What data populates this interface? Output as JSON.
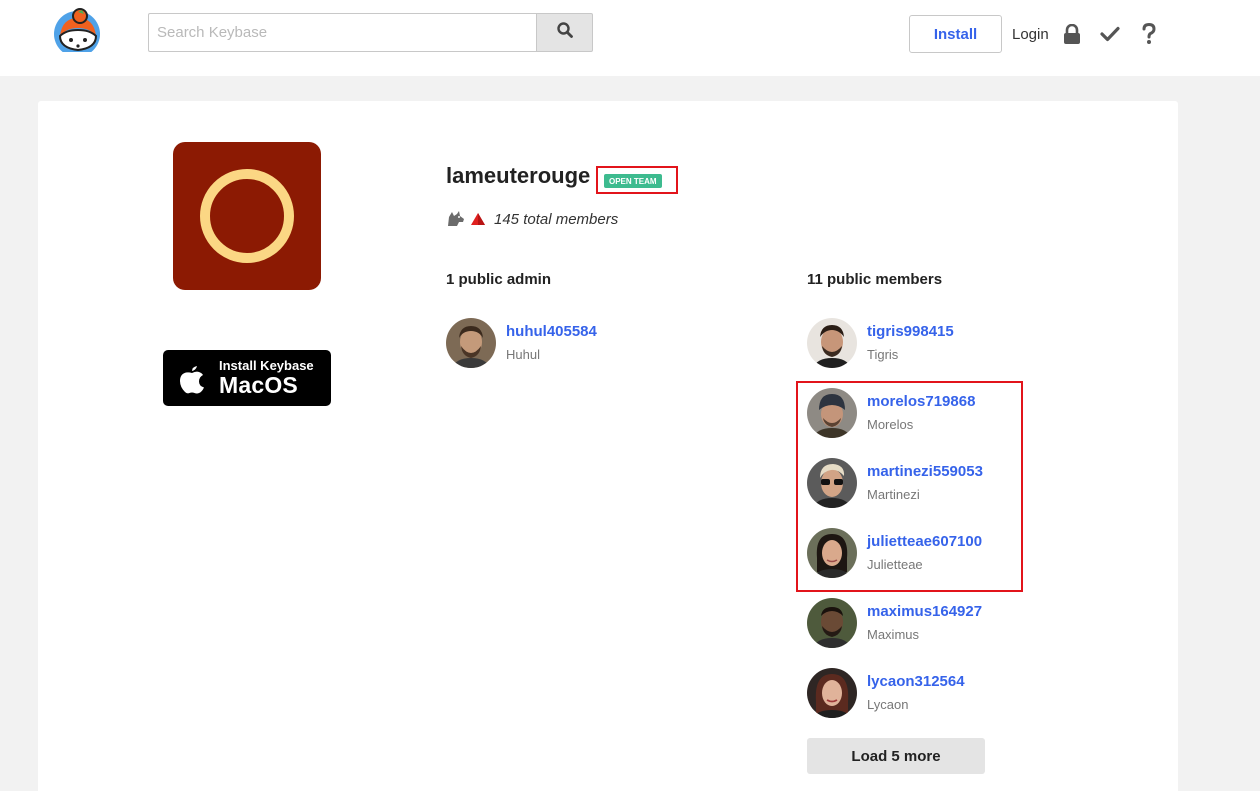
{
  "header": {
    "search": {
      "placeholder": "Search Keybase",
      "value": ""
    },
    "install_label": "Install",
    "login_label": "Login",
    "icons": [
      "keybase-logo-icon",
      "search-icon",
      "lock-icon",
      "check-icon",
      "help-icon"
    ]
  },
  "sidebar": {
    "install_badge": {
      "line1": "Install Keybase",
      "line2": "MacOS"
    }
  },
  "team": {
    "name": "lameuterouge",
    "badge": "OPEN TEAM",
    "total_members": "145 total members",
    "avatar_colors": {
      "background": "#8c1a03",
      "ring": "#fbd784"
    }
  },
  "admins": {
    "title": "1 public admin",
    "items": [
      {
        "username": "huhul405584",
        "full_name": "Huhul"
      }
    ]
  },
  "members": {
    "title": "11 public members",
    "items": [
      {
        "username": "tigris998415",
        "full_name": "Tigris"
      },
      {
        "username": "morelos719868",
        "full_name": "Morelos"
      },
      {
        "username": "martinezi559053",
        "full_name": "Martinezi"
      },
      {
        "username": "julietteae607100",
        "full_name": "Julietteae"
      },
      {
        "username": "maximus164927",
        "full_name": "Maximus"
      },
      {
        "username": "lycaon312564",
        "full_name": "Lycaon"
      }
    ],
    "load_more_label": "Load 5 more"
  },
  "colors": {
    "link": "#3663ea",
    "open_badge": "#3dbb8f",
    "highlight": "#e2141b"
  }
}
